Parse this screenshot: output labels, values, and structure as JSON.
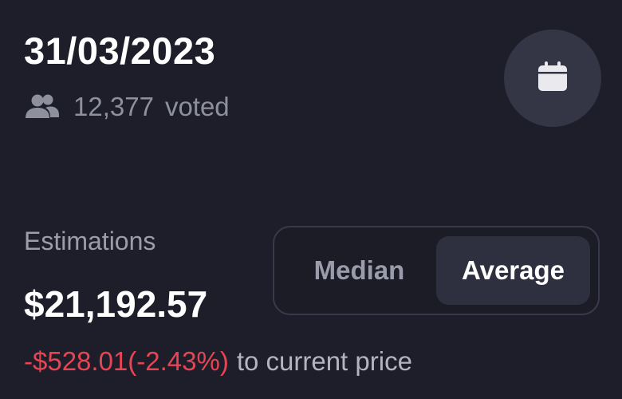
{
  "header": {
    "date": "31/03/2023",
    "vote_count": "12,377",
    "vote_suffix": "voted",
    "users_icon": "users-icon",
    "calendar_icon": "calendar-icon"
  },
  "estimations": {
    "label": "Estimations",
    "price": "$21,192.57",
    "change": "-$528.01(-2.43%)",
    "change_suffix": "to current price",
    "change_color": "#e64553"
  },
  "toggle": {
    "options": [
      "Median",
      "Average"
    ],
    "selected": "Average"
  },
  "colors": {
    "background": "#1e1e2a",
    "button_bg": "#343545",
    "toggle_active_bg": "#2f303f",
    "muted_text": "#8f909e"
  }
}
